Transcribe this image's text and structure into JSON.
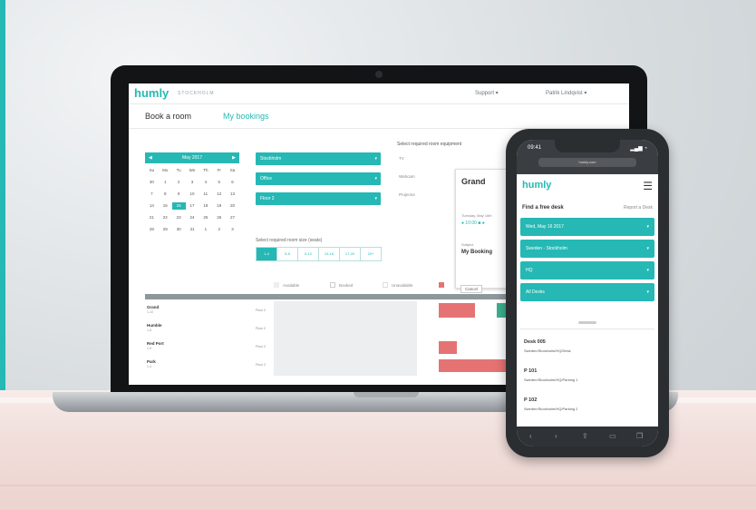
{
  "laptop": {
    "brand": "humly",
    "location": "STOCKHOLM",
    "support": "Support ▾",
    "user": "Patrik Lindqvist ▾",
    "tabs": [
      "Book a room",
      "My bookings"
    ],
    "calendar": {
      "month": "May 2017",
      "days": [
        "Su",
        "Mo",
        "Tu",
        "We",
        "Th",
        "Fr",
        "Sa"
      ],
      "dates": [
        "30",
        "1",
        "2",
        "3",
        "4",
        "5",
        "6",
        "7",
        "8",
        "9",
        "10",
        "11",
        "12",
        "13",
        "14",
        "15",
        "16",
        "17",
        "18",
        "19",
        "20",
        "21",
        "22",
        "23",
        "24",
        "25",
        "26",
        "27",
        "28",
        "29",
        "30",
        "31",
        "1",
        "2",
        "3"
      ],
      "selected": "16"
    },
    "dropdowns": [
      "Stockholm",
      "Office",
      "Floor 2"
    ],
    "capacity_label": "Select required room size (seats)",
    "capacity_options": [
      "1-4",
      "5-8",
      "9-12",
      "13-16",
      "17-20",
      "20+"
    ],
    "equipment_label": "Select required room equipment",
    "equipment": [
      "TV",
      "Webcam",
      "Projector"
    ],
    "panel": {
      "title": "Grand",
      "sub": "Tuesday, May 16th",
      "times": "● 10:00 ■ ●",
      "dlabel": "Subject",
      "name": "My Booking"
    },
    "cancel": "Cancel",
    "legend": [
      "Available",
      "Booked",
      "Unavailable"
    ],
    "rooms": [
      {
        "name": "Grand",
        "sub": "1-10",
        "floor": "Floor 2"
      },
      {
        "name": "Humble",
        "sub": "1-8",
        "floor": "Floor 2"
      },
      {
        "name": "Red Port",
        "sub": "1-6",
        "floor": "Floor 2"
      },
      {
        "name": "Park",
        "sub": "1-4",
        "floor": "Floor 2"
      }
    ]
  },
  "phone": {
    "time": "09:41",
    "signal": "▂▄▆ ◔",
    "url": "humly.com",
    "brand": "humly",
    "find": "Find a free desk",
    "report": "Report a Desk",
    "dropdowns": [
      "Wed, May 16 2017",
      "Sweden - Stockholm",
      "HQ",
      "All Desks"
    ],
    "desks": [
      {
        "name": "Desk 005",
        "sub": "Sweden/Stockholm/HQ/Desk"
      },
      {
        "name": "P 101",
        "sub": "Sweden/Stockholm/HQ/Parking 1"
      },
      {
        "name": "P 102",
        "sub": "Sweden/Stockholm/HQ/Parking 2"
      }
    ]
  },
  "colors": {
    "accent": "#25b8b4",
    "booked": "#e57373",
    "available_alt": "#3bb18f"
  }
}
